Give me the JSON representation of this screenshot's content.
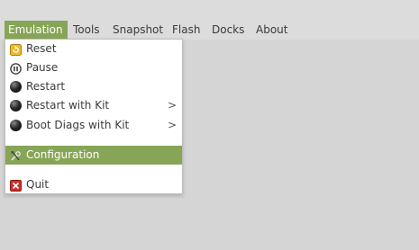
{
  "menubar": {
    "items": [
      {
        "label": "Emulation",
        "active": true
      },
      {
        "label": "Tools"
      },
      {
        "label": "Snapshot"
      },
      {
        "label": "Flash"
      },
      {
        "label": "Docks"
      },
      {
        "label": "About"
      }
    ]
  },
  "emulation_menu": {
    "items": [
      {
        "label": "Reset",
        "icon": "reset-icon"
      },
      {
        "label": "Pause",
        "icon": "pause-icon"
      },
      {
        "label": "Restart",
        "icon": "restart-ball-icon"
      },
      {
        "label": "Restart with Kit",
        "icon": "restart-ball-icon",
        "submenu_arrow": ">"
      },
      {
        "label": "Boot Diags with Kit",
        "icon": "boot-ball-icon",
        "submenu_arrow": ">"
      },
      {
        "label": "Configuration",
        "icon": "wrench-screwdriver-icon",
        "highlighted": true
      },
      {
        "label": "Quit",
        "icon": "quit-x-icon"
      }
    ]
  },
  "colors": {
    "accent": "#87a556",
    "background": "#d6d6d6",
    "menu_background": "#ffffff",
    "quit_icon": "#c8312b",
    "reset_icon": "#f1b928"
  }
}
